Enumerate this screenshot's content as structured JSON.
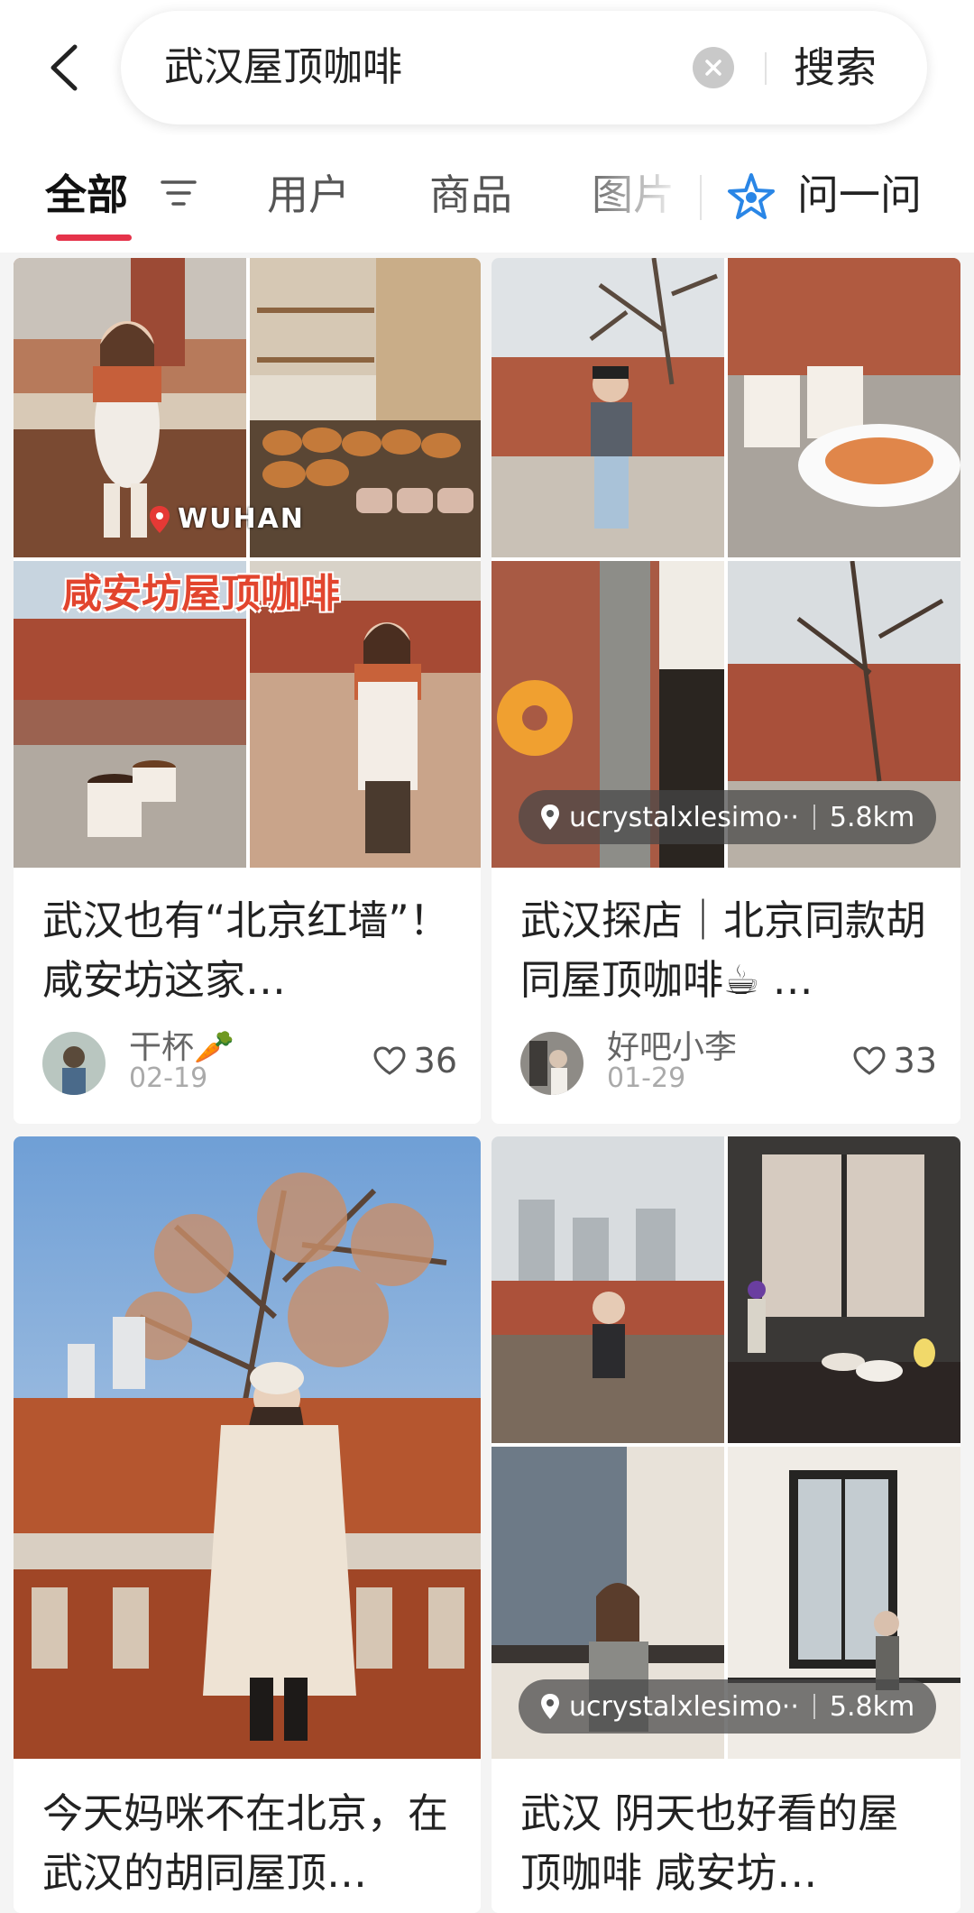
{
  "search": {
    "query": "武汉屋顶咖啡",
    "button_label": "搜索"
  },
  "tabs": {
    "items": [
      "全部",
      "用户",
      "商品",
      "图片"
    ],
    "ask_label": "问一问"
  },
  "colors": {
    "accent": "#e5334a",
    "ask_icon": "#2a86e6"
  },
  "posts": [
    {
      "title": "武汉也有“北京红墙”！ 咸安坊这家…",
      "author": "干杯🥕",
      "date": "02-19",
      "likes": "36",
      "overlay_tag": "WUHAN",
      "overlay_title": "咸安坊屋顶咖啡"
    },
    {
      "title": "武汉探店｜北京同款胡同屋顶咖啡☕ …",
      "author": "好吧小李",
      "date": "01-29",
      "likes": "33",
      "location": "ucrystalxlesimo··",
      "distance": "5.8km"
    },
    {
      "title": "今天妈咪不在北京，在武汉的胡同屋顶…"
    },
    {
      "title": "武汉 阴天也好看的屋顶咖啡 咸安坊…",
      "location": "ucrystalxlesimo··",
      "distance": "5.8km"
    }
  ]
}
